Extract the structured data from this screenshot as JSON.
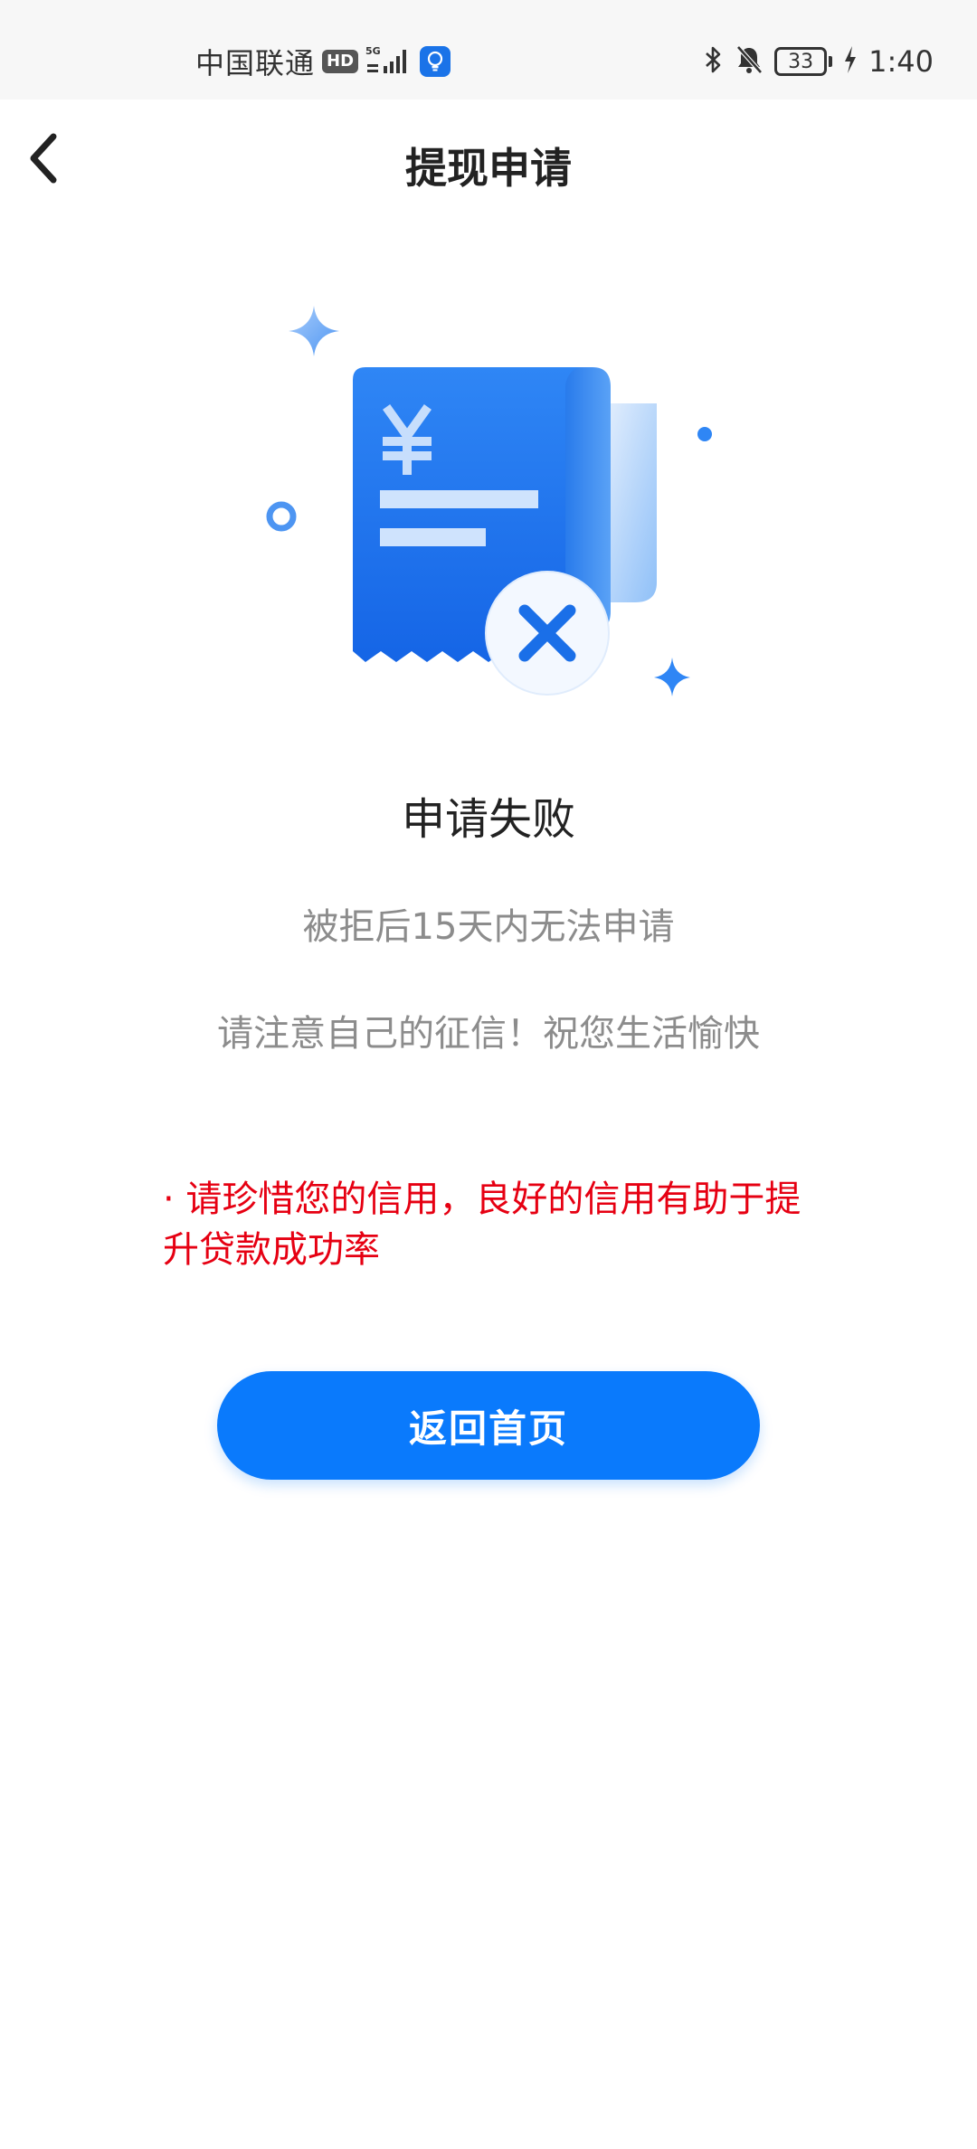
{
  "status_bar": {
    "carrier": "中国联通",
    "hd_label": "HD",
    "network_label": "5G",
    "battery_level": "33",
    "time": "1:40"
  },
  "nav": {
    "title": "提现申请",
    "back_icon": "chevron-left-icon"
  },
  "result": {
    "illustration_icon": "receipt-failed-icon",
    "title": "申请失败",
    "line1": "被拒后15天内无法申请",
    "line2": "请注意自己的征信！祝您生活愉快"
  },
  "tip": {
    "text": "· 请珍惜您的信用，良好的信用有助于提升贷款成功率",
    "color": "#e60012"
  },
  "actions": {
    "home_label": "返回首页"
  },
  "colors": {
    "accent": "#0a7afc",
    "status_bar_bg": "#f7f7f7",
    "secondary_text": "#8c8c8c"
  }
}
